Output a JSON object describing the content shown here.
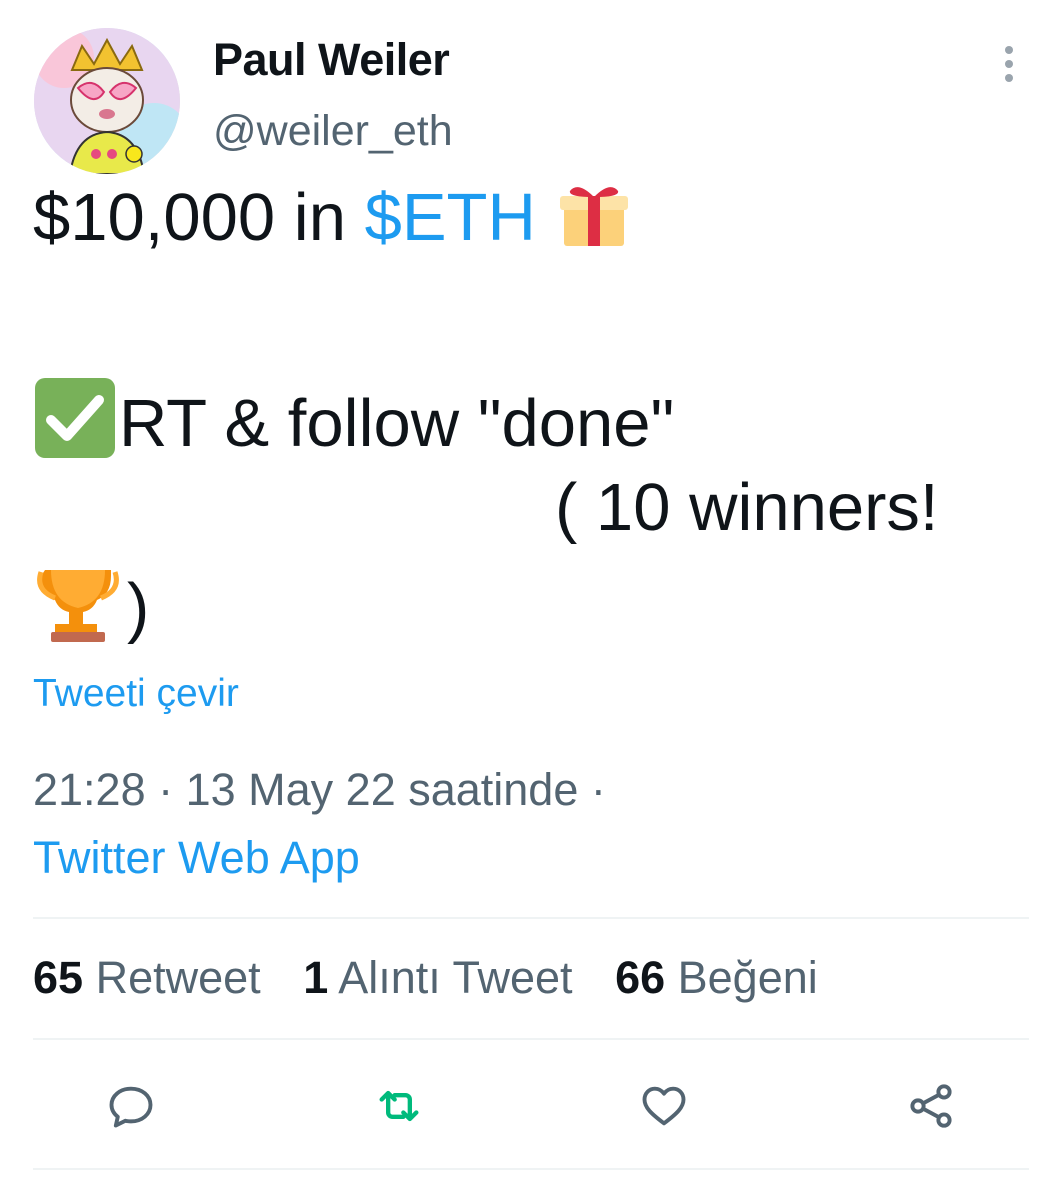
{
  "author": {
    "display_name": "Paul Weiler",
    "handle": "@weiler_eth"
  },
  "tweet": {
    "line1_prefix": "$10,000 in ",
    "cashtag": "$ETH",
    "line2": "RT & follow \"done\"",
    "line3": "( 10 winners!",
    "line4_suffix": ")"
  },
  "translate_label": "Tweeti çevir",
  "meta": {
    "timestamp": "21:28 · 13 May 22 saatinde ·",
    "source": "Twitter Web App"
  },
  "stats": {
    "retweets": {
      "count": "65",
      "label": "Retweet"
    },
    "quotes": {
      "count": "1",
      "label": "Alıntı Tweet"
    },
    "likes": {
      "count": "66",
      "label": "Beğeni"
    }
  },
  "icons": {
    "more": "more-vertical-icon",
    "reply": "reply-icon",
    "retweet": "retweet-icon",
    "like": "heart-icon",
    "share": "share-icon"
  },
  "colors": {
    "link": "#1d9bf0",
    "secondary_text": "#536471",
    "retweet_green": "#00ba7c",
    "action_icon": "#536471"
  }
}
